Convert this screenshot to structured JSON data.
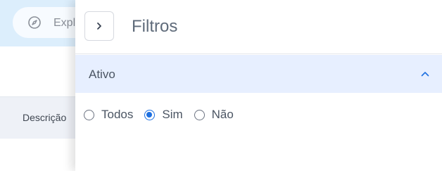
{
  "background": {
    "search_placeholder": "Expl",
    "table_column": "Descrição",
    "search_icon": "compass-icon"
  },
  "drawer": {
    "title": "Filtros",
    "close_icon": "chevron-right-icon",
    "sections": [
      {
        "title": "Ativo",
        "expanded": true,
        "toggle_icon": "chevron-up-icon",
        "options": [
          {
            "label": "Todos",
            "selected": false
          },
          {
            "label": "Sim",
            "selected": true
          },
          {
            "label": "Não",
            "selected": false
          }
        ]
      }
    ]
  },
  "colors": {
    "accent": "#1d6fe0",
    "header_band": "#dceefc",
    "section_header_bg": "#e7efff"
  }
}
